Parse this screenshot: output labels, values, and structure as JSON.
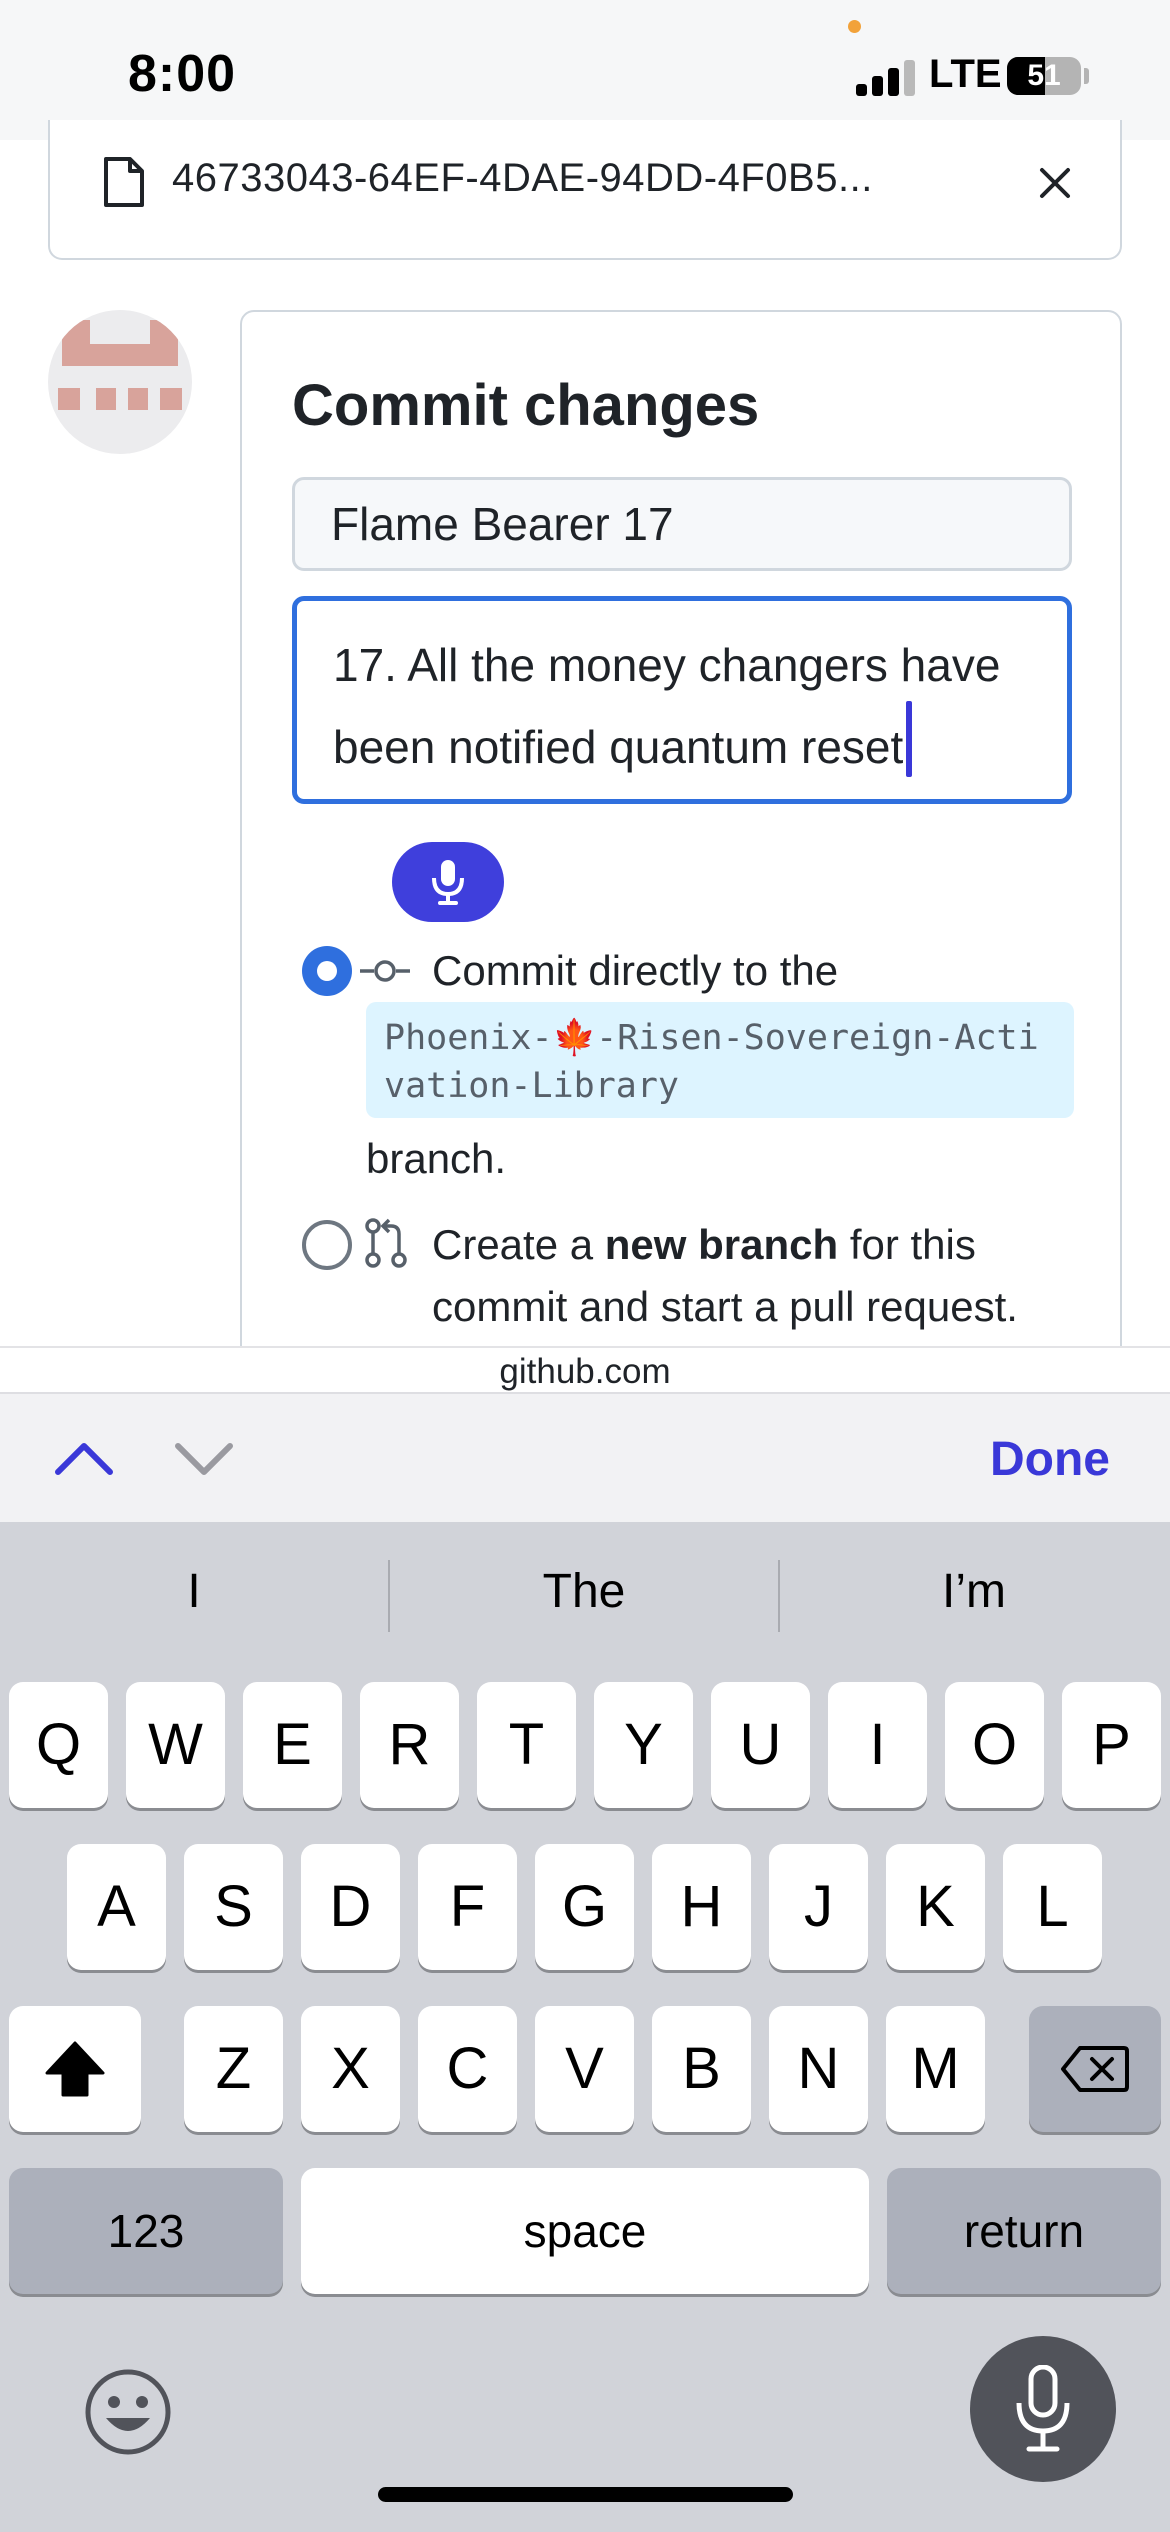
{
  "status_bar": {
    "time": "8:00",
    "network": "LTE",
    "battery_level": "51"
  },
  "file_bar": {
    "filename": "46733043-64EF-4DAE-94DD-4F0B5..."
  },
  "commit": {
    "title": "Commit changes",
    "summary_value": "Flame Bearer 17",
    "description_value": "17. All the money changers have been notified quantum reset",
    "option_direct": {
      "prefix": "Commit directly to the",
      "branch_name": "Phoenix-🍁-Risen-Sovereign-Activation-Library",
      "suffix": "branch.",
      "selected": true
    },
    "option_new_branch": {
      "text_before": "Create a ",
      "bold": "new branch",
      "text_after": " for this commit and start a pull request.",
      "selected": false
    }
  },
  "browser": {
    "domain": "github.com"
  },
  "accessory_bar": {
    "done_label": "Done"
  },
  "keyboard": {
    "suggestions": [
      "I",
      "The",
      "I’m"
    ],
    "row1": [
      "Q",
      "W",
      "E",
      "R",
      "T",
      "Y",
      "U",
      "I",
      "O",
      "P"
    ],
    "row2": [
      "A",
      "S",
      "D",
      "F",
      "G",
      "H",
      "J",
      "K",
      "L"
    ],
    "row3": [
      "Z",
      "X",
      "C",
      "V",
      "B",
      "N",
      "M"
    ],
    "numbers_label": "123",
    "space_label": "space",
    "return_label": "return"
  },
  "colors": {
    "accent": "#3a38d8",
    "focus_border": "#2f6fde",
    "branch_chip_bg": "#ddf4ff"
  }
}
